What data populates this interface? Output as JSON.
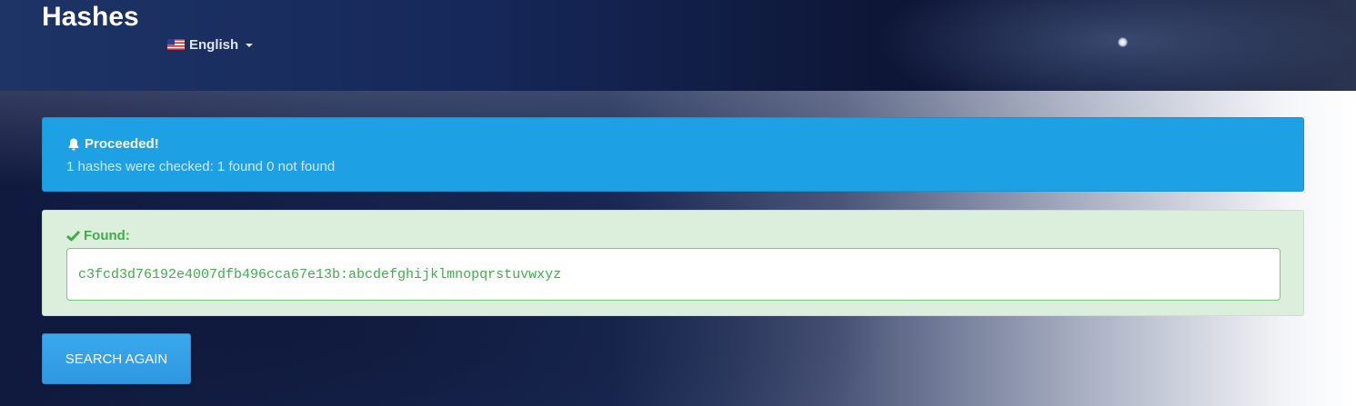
{
  "header": {
    "title": "Hashes",
    "language": {
      "label": "English",
      "flag_icon": "us-flag-icon"
    }
  },
  "info_alert": {
    "title": "Proceeded!",
    "message": "1 hashes were checked: 1 found 0 not found",
    "icon": "bell-icon",
    "color": "#1ea1e4"
  },
  "found_alert": {
    "title": "Found:",
    "icon": "check-icon",
    "result": "c3fcd3d76192e4007dfb496cca67e13b:abcdefghijklmnopqrstuvwxyz",
    "color": "#3fae49"
  },
  "actions": {
    "search_again_label": "SEARCH AGAIN"
  }
}
